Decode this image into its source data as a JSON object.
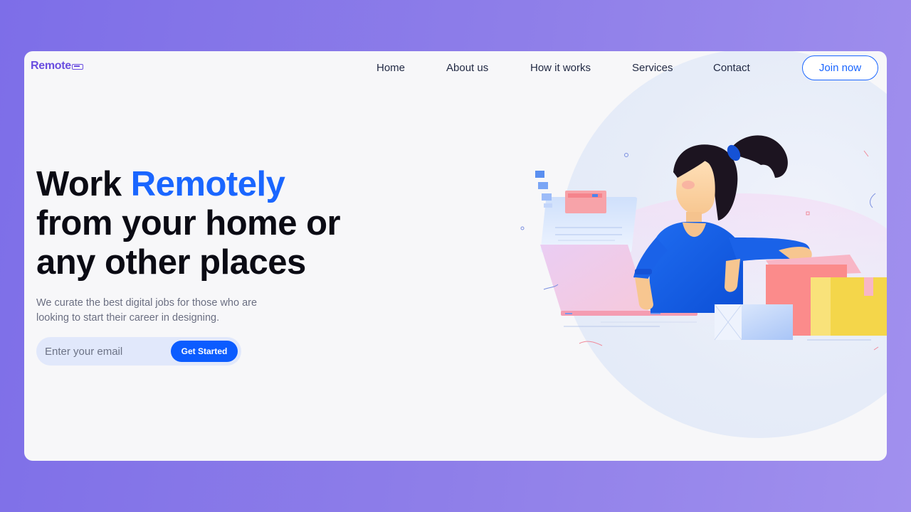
{
  "brand": {
    "name": "Remote"
  },
  "nav": {
    "items": [
      {
        "label": "Home"
      },
      {
        "label": "About us"
      },
      {
        "label": "How it works"
      },
      {
        "label": "Services"
      },
      {
        "label": "Contact"
      }
    ],
    "cta_label": "Join now"
  },
  "hero": {
    "title_part1": "Work",
    "title_accent": "Remotely",
    "title_line2": "from your home or",
    "title_line3": "any other places",
    "subtitle": "We curate the best digital jobs for those who are looking to start their career in designing.",
    "email_placeholder": "Enter your email",
    "email_value": "",
    "submit_label": "Get Started"
  },
  "colors": {
    "background_gradient": [
      "#7d6ee8",
      "#a190ee"
    ],
    "accent": "#1a66ff",
    "brand": "#6a4ee0",
    "card_bg": "#f7f7f9",
    "heading": "#0b0b14"
  },
  "icons": [
    "remote-logo-icon",
    "woman-at-laptop-illustration"
  ]
}
